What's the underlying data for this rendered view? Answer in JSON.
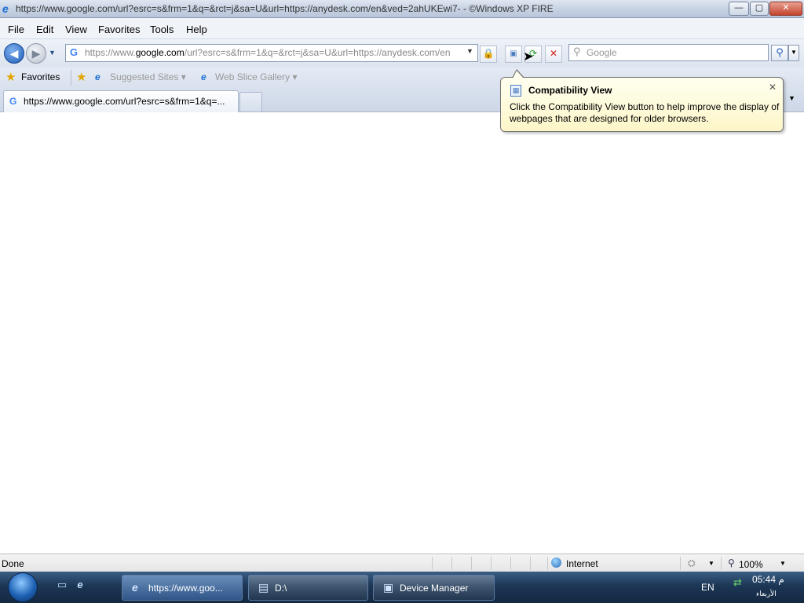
{
  "window": {
    "title": "https://www.google.com/url?esrc=s&frm=1&q=&rct=j&sa=U&url=https://anydesk.com/en&ved=2ahUKEwi7- - ©Windows XP FIRE",
    "min": "—",
    "max": "▢",
    "close": "✕"
  },
  "menu": [
    "File",
    "Edit",
    "View",
    "Favorites",
    "Tools",
    "Help"
  ],
  "address": {
    "host_prefix": "https://www.",
    "host": "google.com",
    "path": "/url?esrc=s&frm=1&q=&rct=j&sa=U&url=https://anydesk.com/en",
    "favicon": "G"
  },
  "search": {
    "placeholder": "Google"
  },
  "favorites": {
    "label": "Favorites",
    "links": [
      {
        "label": "Suggested Sites ▾"
      },
      {
        "label": "Web Slice Gallery ▾"
      }
    ]
  },
  "tabs": [
    {
      "title": "https://www.google.com/url?esrc=s&frm=1&q=...",
      "favicon": "G"
    }
  ],
  "tooltip": {
    "title": "Compatibility View",
    "body": "Click the Compatibility View button to help improve the display of webpages that are designed for older browsers.",
    "close": "✕"
  },
  "status": {
    "text": "Done",
    "zone": "Internet",
    "zoom": "100%"
  },
  "taskbar": {
    "items": [
      {
        "label": "https://www.goo..."
      },
      {
        "label": "D:\\"
      },
      {
        "label": "Device Manager"
      }
    ],
    "lang": "EN",
    "time": "05:44 م",
    "day": "الأربعاء"
  },
  "colors": {
    "taskbar": "#1c3655",
    "tooltip_bg": "#fffff0",
    "accent": "#1f5cb8"
  }
}
